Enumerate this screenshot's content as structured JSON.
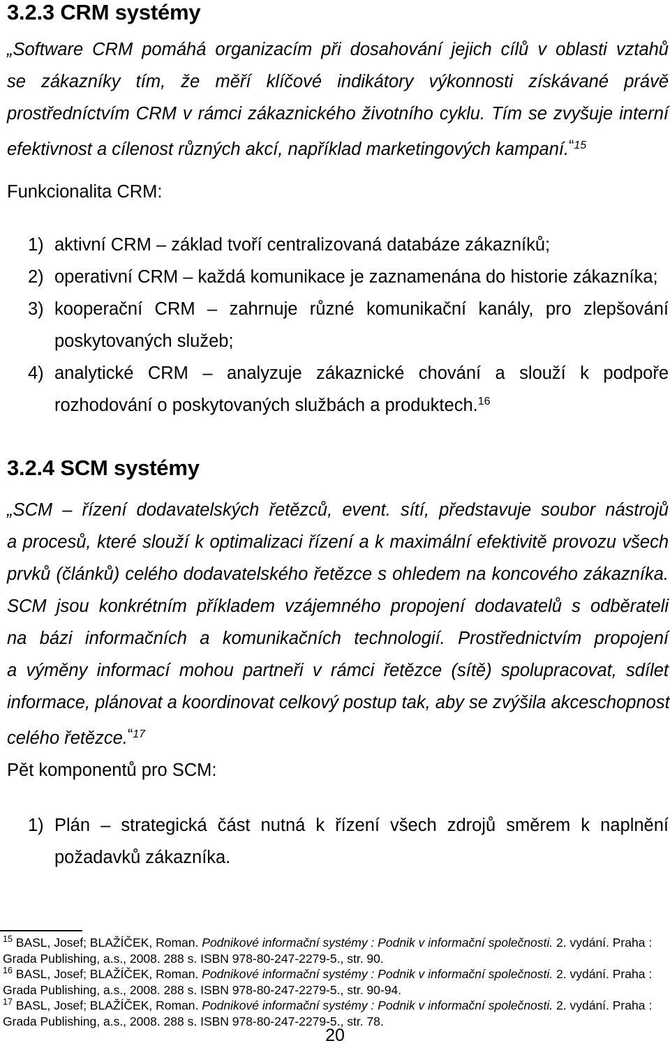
{
  "document": {
    "page_number": "20",
    "sections": [
      {
        "heading": "3.2.3 CRM systémy",
        "quote_lines": [
          "„Software CRM pomáhá organizacím při dosahování jejich cílů v oblasti vztahů",
          "se zákazníky tím, že měří klíčové indikátory výkonnosti získávané právě",
          "prostředníctvím CRM v rámci zákaznického životního cyklu. Tím se zvyšuje interní",
          "efektivnost a cílenost různých akcí, například marketingových kampaní."
        ],
        "quote_footnote_marker": "15",
        "list_label": "Funkcionalita CRM:",
        "list_items": [
          {
            "marker": "1)",
            "lines": [
              "aktivní CRM – základ tvoří centralizovaná databáze zákazníků;"
            ]
          },
          {
            "marker": "2)",
            "lines": [
              "operativní CRM – každá komunikace je zaznamenána do historie zákazníka;"
            ]
          },
          {
            "marker": "3)",
            "lines": [
              "kooperační CRM – zahrnuje různé komunikační kanály, pro zlepšování",
              "poskytovaných služeb;"
            ]
          },
          {
            "marker": "4)",
            "lines": [
              "analytické CRM – analyzuje zákaznické chování a slouží k podpoře",
              "rozhodování o poskytovaných službách a produktech."
            ],
            "footnote_marker": "16"
          }
        ]
      },
      {
        "heading": "3.2.4 SCM systémy",
        "quote_lines": [
          "„SCM – řízení dodavatelských řetězců, event. sítí, představuje soubor nástrojů",
          "a procesů, které slouží k optimalizaci řízení a k maximální efektivitě provozu všech",
          "prvků (článků) celého dodavatelského řetězce s ohledem na koncového zákazníka.",
          "SCM jsou konkrétním příkladem vzájemného propojení dodavatelů s odběrateli",
          "na bázi informačních a komunikačních technologií. Prostřednictvím propojení",
          "a výměny informací mohou partneři v rámci řetězce (sítě) spolupracovat, sdílet",
          "informace, plánovat a koordinovat celkový postup tak, aby se zvýšila akceschopnost",
          "celého řetězce."
        ],
        "quote_footnote_marker": "17",
        "list_label": "Pět komponentů pro SCM:",
        "list_items": [
          {
            "marker": "1)",
            "lines": [
              "Plán – strategická část nutná k řízení všech zdrojů směrem k naplnění",
              "požadavků zákazníka."
            ]
          }
        ]
      }
    ],
    "footnotes": [
      {
        "ref": "15",
        "pre": " BASL, Josef; BLAŽÍČEK, Roman. ",
        "title": "Podnikové informační systémy : Podnik v informační společnosti.",
        "post": " 2. vydání. Praha : Grada Publishing, a.s., 2008. 288 s. ISBN 978-80-247-2279-5., str. 90."
      },
      {
        "ref": "16",
        "pre": " BASL, Josef; BLAŽÍČEK, Roman. ",
        "title": "Podnikové informační systémy : Podnik v informační společnosti.",
        "post": " 2. vydání. Praha : Grada Publishing, a.s., 2008. 288 s. ISBN 978-80-247-2279-5., str. 90-94."
      },
      {
        "ref": "17",
        "pre": " BASL, Josef; BLAŽÍČEK, Roman. ",
        "title": "Podnikové informační systémy : Podnik v informační společnosti.",
        "post": " 2. vydání. Praha : Grada Publishing, a.s., 2008. 288 s. ISBN 978-80-247-2279-5., str. 78."
      }
    ]
  }
}
